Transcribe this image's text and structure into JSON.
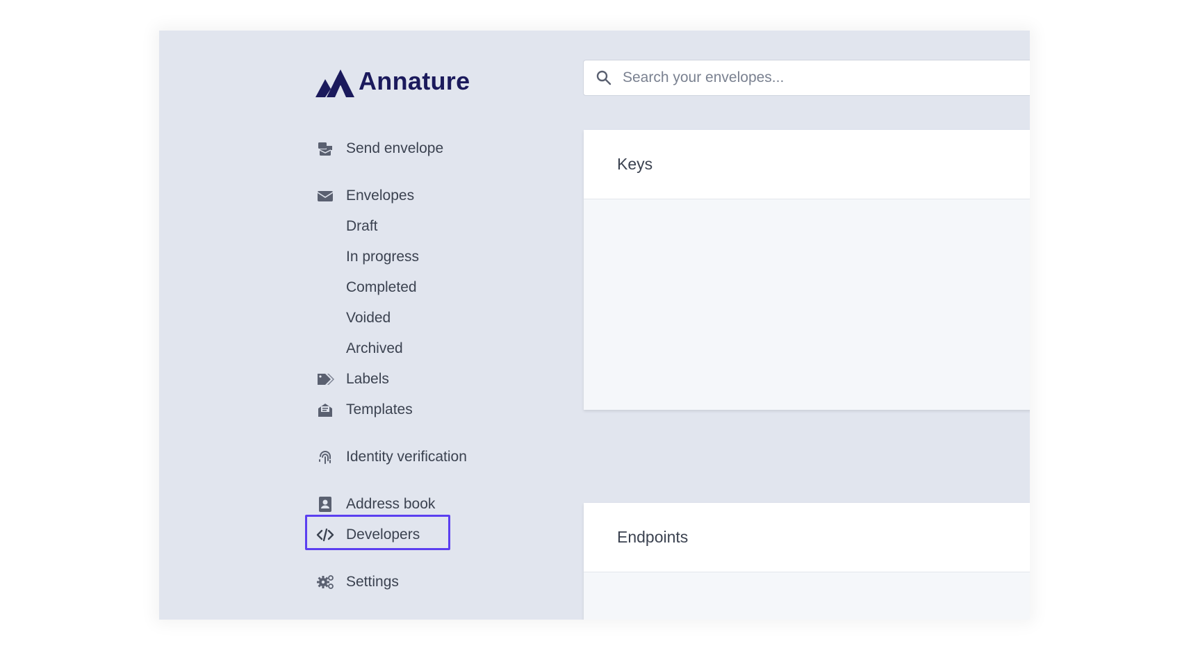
{
  "brand": {
    "name": "Annature",
    "color": "#1b1a5c"
  },
  "search": {
    "placeholder": "Search your envelopes..."
  },
  "sidebar": {
    "items": [
      {
        "label": "Send envelope",
        "icon": "send-envelope-icon"
      },
      {
        "label": "Envelopes",
        "icon": "envelope-icon"
      },
      {
        "label": "Draft"
      },
      {
        "label": "In progress"
      },
      {
        "label": "Completed"
      },
      {
        "label": "Voided"
      },
      {
        "label": "Archived"
      },
      {
        "label": "Labels",
        "icon": "tags-icon"
      },
      {
        "label": "Templates",
        "icon": "templates-icon"
      },
      {
        "label": "Identity verification",
        "icon": "fingerprint-icon"
      },
      {
        "label": "Address book",
        "icon": "address-book-icon"
      },
      {
        "label": "Developers",
        "icon": "code-icon",
        "highlighted": true
      },
      {
        "label": "Settings",
        "icon": "gear-icon"
      }
    ]
  },
  "main": {
    "cards": [
      {
        "title": "Keys"
      },
      {
        "title": "Endpoints"
      }
    ]
  },
  "colors": {
    "highlight": "#5b3ff0",
    "background": "#e1e5ee",
    "text": "#3b4250"
  }
}
